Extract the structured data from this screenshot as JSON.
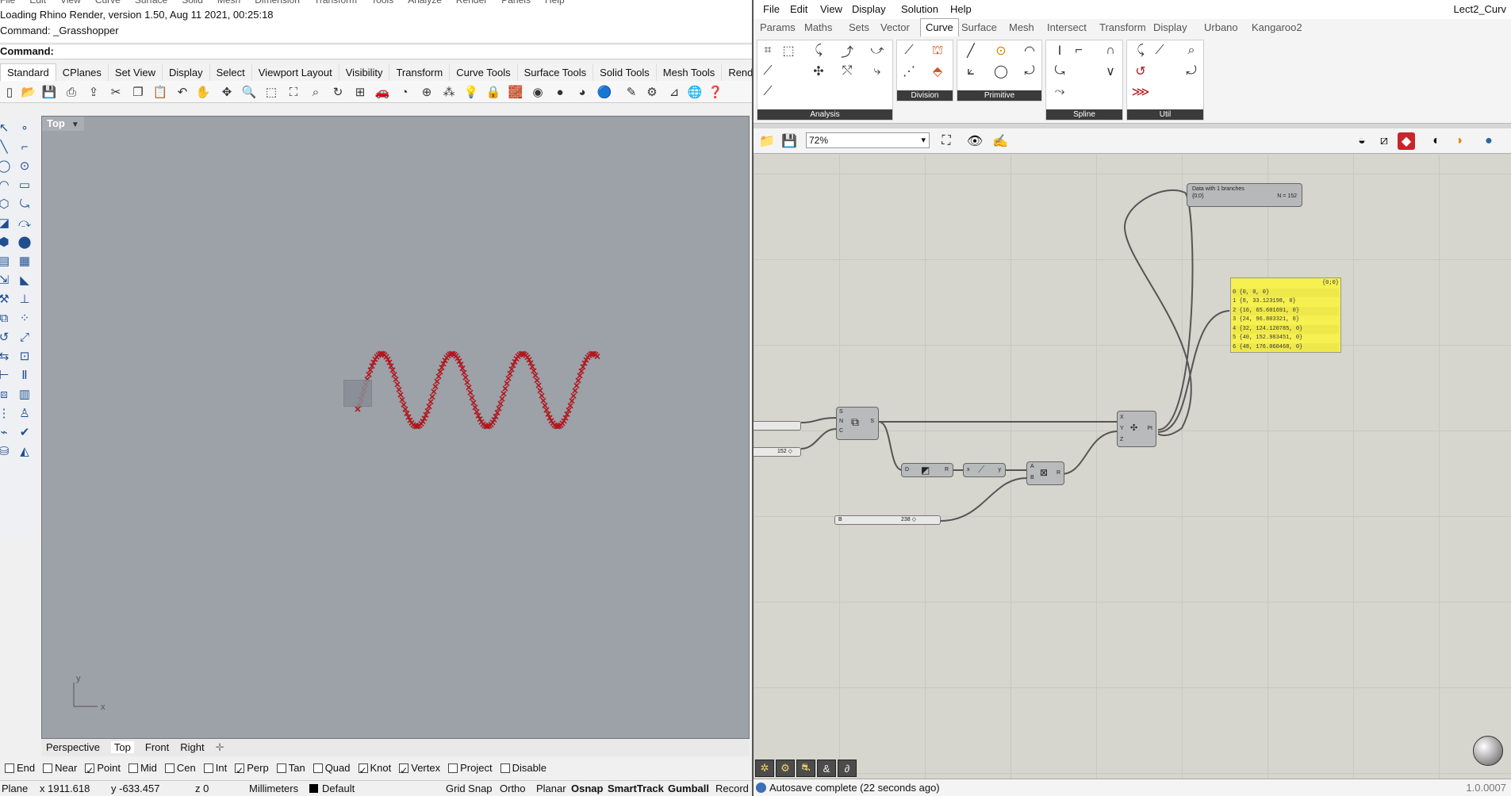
{
  "rhino": {
    "menubar": [
      "File",
      "Edit",
      "View",
      "Curve",
      "Surface",
      "Solid",
      "Mesh",
      "Dimension",
      "Transform",
      "Tools",
      "Analyze",
      "Render",
      "Panels",
      "Help"
    ],
    "command_history": [
      "Loading Rhino Render, version 1.50, Aug 11 2021, 00:25:18",
      "Command: _Grasshopper"
    ],
    "command_prompt": "Command:",
    "toolbar_tabs": [
      "Standard",
      "CPlanes",
      "Set View",
      "Display",
      "Select",
      "Viewport Layout",
      "Visibility",
      "Transform",
      "Curve Tools",
      "Surface Tools",
      "Solid Tools",
      "Mesh Tools",
      "Render"
    ],
    "active_toolbar_tab": "Standard",
    "viewport": {
      "title": "Top",
      "curve_color": "#b0171f",
      "background_color": "#9da1a8",
      "axis_labels": {
        "x": "x",
        "y": "y"
      }
    },
    "viewport_tabs": [
      "Perspective",
      "Top",
      "Front",
      "Right"
    ],
    "viewport_add": "✛",
    "osnaps": [
      {
        "label": "End",
        "checked": false
      },
      {
        "label": "Near",
        "checked": false
      },
      {
        "label": "Point",
        "checked": true
      },
      {
        "label": "Mid",
        "checked": false
      },
      {
        "label": "Cen",
        "checked": false
      },
      {
        "label": "Int",
        "checked": false
      },
      {
        "label": "Perp",
        "checked": true
      },
      {
        "label": "Tan",
        "checked": false
      },
      {
        "label": "Quad",
        "checked": false
      },
      {
        "label": "Knot",
        "checked": true
      },
      {
        "label": "Vertex",
        "checked": true
      },
      {
        "label": "Project",
        "checked": false
      },
      {
        "label": "Disable",
        "checked": false
      }
    ],
    "status": {
      "cplane": "Plane",
      "x": "x 1911.618",
      "y": "y -633.457",
      "z": "z 0",
      "units": "Millimeters",
      "layer": "Default",
      "toggles": [
        "Grid Snap",
        "Ortho",
        "Planar",
        "Osnap",
        "SmartTrack",
        "Gumball",
        "Record"
      ]
    }
  },
  "grasshopper": {
    "menubar": [
      "File",
      "Edit",
      "View",
      "Display",
      "Solution",
      "Help"
    ],
    "document_title": "Lect2_Curv",
    "tabs": [
      "Params",
      "Maths",
      "Sets",
      "Vector",
      "Curve",
      "Surface",
      "Mesh",
      "Intersect",
      "Transform",
      "Display",
      "Urbano",
      "Kangaroo2"
    ],
    "active_tab": "Curve",
    "ribbon_groups": [
      "Analysis",
      "Division",
      "Primitive",
      "Spline",
      "Util"
    ],
    "zoom": "72%",
    "canvas": {
      "param_box": {
        "line1": "Data with 1 branches",
        "line2_left": "{0;0}",
        "line2_right": "N = 152"
      },
      "panel": {
        "header": "{0;0}",
        "rows": [
          "0 {0, 0, 0}",
          "1 {8, 33.123198, 0}",
          "2 {16, 65.601691, 0}",
          "3 {24, 96.803321, 0}",
          "4 {32, 124.120785, 0}",
          "5 {40, 152.983451, 0}",
          "6 {48, 176.060468, 0}"
        ]
      },
      "slider_count": "152 ◇",
      "slider_b": {
        "label": "B",
        "value": "238 ◇"
      },
      "series_ports": {
        "in": [
          "S",
          "N",
          "C"
        ],
        "out": "S"
      },
      "construct_point_ports": {
        "in": [
          "X",
          "Y",
          "Z"
        ],
        "out": "Pt"
      },
      "divide_ports": {
        "in": "D",
        "out": "R"
      },
      "sine_ports": {
        "in": "x",
        "out": "y"
      },
      "multiply_ports": {
        "in": [
          "A",
          "B"
        ],
        "out": "R"
      }
    },
    "status": {
      "message": "Autosave complete (22 seconds ago)",
      "version": "1.0.0007"
    }
  }
}
